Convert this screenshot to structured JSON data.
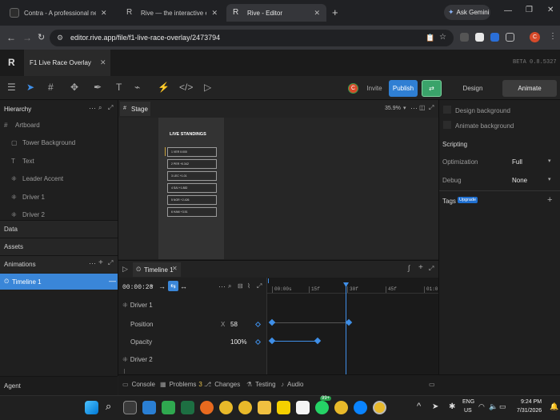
{
  "browser": {
    "tabs": [
      {
        "label": "Contra - A professional netwo",
        "active": false,
        "favicon_color": "#1a1a1a"
      },
      {
        "label": "Rive — the interactive experien",
        "active": false,
        "favicon_color": "#1a1a1a"
      },
      {
        "label": "Rive - Editor",
        "active": true,
        "favicon_color": "#1a1a1a"
      }
    ],
    "ask_gemini": "Ask Gemini",
    "url": "editor.rive.app/file/f1-live-race-overlay/2473794",
    "profile_initial": "C"
  },
  "app": {
    "file_tab": "F1 Live Race Overlay",
    "version": "BETA 0.8.5327",
    "invite_label": "Invite",
    "publish_label": "Publish",
    "mode_design": "Design",
    "mode_animate": "Animate",
    "avatar_initial": "C"
  },
  "hierarchy": {
    "title": "Hierarchy",
    "items": [
      {
        "label": "Artboard",
        "icon": "artboard-icon"
      },
      {
        "label": "Tower Background",
        "icon": "rectangle-icon"
      },
      {
        "label": "Text",
        "icon": "text-icon"
      },
      {
        "label": "Leader Accent",
        "icon": "group-icon"
      },
      {
        "label": "Driver 1",
        "icon": "group-icon"
      },
      {
        "label": "Driver 2",
        "icon": "group-icon"
      }
    ],
    "data_label": "Data",
    "assets_label": "Assets",
    "animations_label": "Animations",
    "timeline_item": "Timeline 1",
    "agent_label": "Agent"
  },
  "stage": {
    "tab": "Stage",
    "zoom": "35.9%",
    "board_title": "LIVE STANDINGS",
    "standings": [
      "1  VER  0:000",
      "2  PER  +0.342",
      "3  LEC  +1.01",
      "4  SAI  +1.882",
      "5  NOR  +2.426",
      "6  HAM  +3.51"
    ]
  },
  "inspector": {
    "design_background": "Design background",
    "animate_background": "Animate background",
    "scripting": "Scripting",
    "optimization_label": "Optimization",
    "optimization_value": "Full",
    "debug_label": "Debug",
    "debug_value": "None",
    "tags_label": "Tags",
    "upgrade_badge": "Upgrade"
  },
  "timeline": {
    "tab": "Timeline 1",
    "time": "00:00:28",
    "ruler": [
      "00:00s",
      "15f",
      "30f",
      "45f",
      "01:0"
    ],
    "playhead_fraction": 0.46,
    "rows": [
      {
        "label": "Driver 1",
        "kind": "group"
      },
      {
        "label": "Position",
        "kind": "prop",
        "axis": "X",
        "value": "58"
      },
      {
        "label": "Opacity",
        "kind": "prop",
        "axis": "",
        "value": "100%"
      },
      {
        "label": "Driver 2",
        "kind": "group"
      }
    ]
  },
  "bottom_tabs": [
    {
      "label": "Console",
      "icon": "console-icon"
    },
    {
      "label": "Problems",
      "icon": "problems-icon",
      "badge": "3"
    },
    {
      "label": "Changes",
      "icon": "changes-icon"
    },
    {
      "label": "Testing",
      "icon": "testing-icon"
    },
    {
      "label": "Audio",
      "icon": "audio-icon"
    }
  ],
  "taskbar": {
    "lang_top": "ENG",
    "lang_bottom": "US",
    "time": "9:24 PM",
    "date": "7/31/2026",
    "badge": "99+"
  },
  "colors": {
    "accent": "#3f8fe8",
    "publish": "#2f7fd3",
    "selected_row": "#3a86d8",
    "avatar": "#d64a2a",
    "upgrade": "#1f6fd0"
  }
}
